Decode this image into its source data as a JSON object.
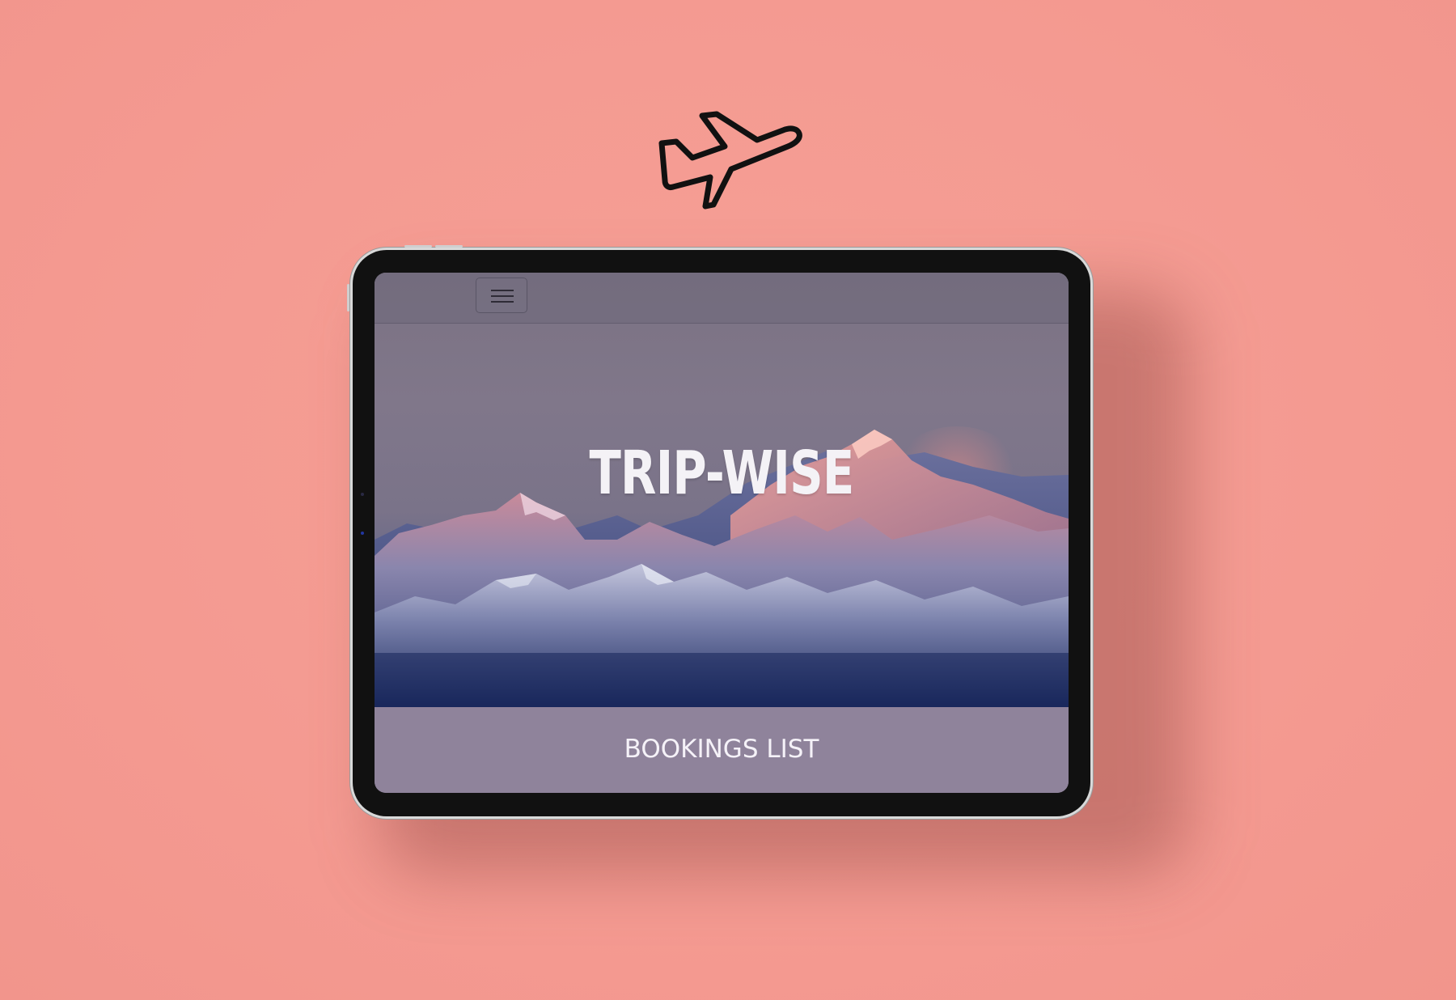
{
  "background": {
    "color": "#f49a91"
  },
  "icons": {
    "top": "airplane-takeoff-icon",
    "menu": "hamburger-menu-icon"
  },
  "app": {
    "brand_title": "TRIP-WISE",
    "bookings_label": "BOOKINGS LIST"
  },
  "colors": {
    "device_frame": "#111111",
    "hero_sky": "#7b7283",
    "hero_base": "#1f2e63",
    "bookings_bar": "#8f839b",
    "text_light": "#f4f2f6"
  }
}
